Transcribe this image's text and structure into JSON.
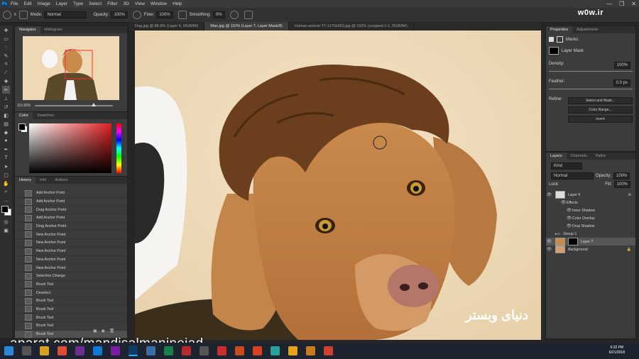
{
  "app": {
    "logo": "Ps",
    "menu": [
      "File",
      "Edit",
      "Image",
      "Layer",
      "Type",
      "Select",
      "Filter",
      "3D",
      "View",
      "Window",
      "Help"
    ],
    "watermark": "w0w.ir",
    "window_controls": [
      "—",
      "❐",
      "✕"
    ]
  },
  "options": {
    "mode_label": "Mode:",
    "mode_value": "Normal",
    "opacity_label": "Opacity:",
    "opacity_value": "100%",
    "flow_label": "Flow:",
    "flow_value": "100%",
    "smoothing_label": "Smoothing:",
    "smoothing_value": "0%",
    "brush_size": "5"
  },
  "navigator": {
    "tabs": [
      "Navigator",
      "Histogram"
    ],
    "zoom": "110.96%"
  },
  "color": {
    "tabs": [
      "Color",
      "Swatches"
    ]
  },
  "history": {
    "tabs": [
      "History",
      "Info",
      "Actions"
    ],
    "items": [
      "Add Anchor Point",
      "Add Anchor Point",
      "Drag Anchor Point",
      "Add Anchor Point",
      "Drag Anchor Point",
      "New Anchor Point",
      "New Anchor Point",
      "New Anchor Point",
      "New Anchor Point",
      "New Anchor Point",
      "Selection Change",
      "Brush Tool",
      "Deselect",
      "Brush Tool",
      "Brush Tool",
      "Brush Tool",
      "Brush Tool",
      "Brush Tool"
    ]
  },
  "doc_tabs": [
    "Dog.jpg @ 86.8% (Layer 6, RGB/8#)",
    "Man.jpg @ 110% (Layer 7, Layer Mask/8)",
    "Human-animal-YT-1170x563.jpg @ 102% (cropped-1-1, RGB/8#)"
  ],
  "properties": {
    "tabs": [
      "Properties",
      "Adjustments"
    ],
    "title": "Masks",
    "mask_label": "Layer Mask",
    "density_label": "Density:",
    "density_value": "100%",
    "feather_label": "Feather:",
    "feather_value": "0.0 px",
    "refine_label": "Refine:",
    "buttons": [
      "Select and Mask...",
      "Color Range...",
      "Invert"
    ]
  },
  "layers": {
    "tabs": [
      "Layers",
      "Channels",
      "Paths"
    ],
    "kind": "Kind",
    "blend": "Normal",
    "opacity_label": "Opacity:",
    "opacity_value": "100%",
    "lock_label": "Lock:",
    "fill_label": "Fill:",
    "fill_value": "100%",
    "rows": [
      {
        "name": "Layer 6",
        "fx": "fx"
      },
      {
        "name": "Effects"
      },
      {
        "name": "Inner Shadow"
      },
      {
        "name": "Color Overlay"
      },
      {
        "name": "Drop Shadow"
      },
      {
        "name": "Group 1"
      },
      {
        "name": "Layer 7"
      },
      {
        "name": "Background"
      }
    ]
  },
  "overlay": {
    "aparat": "aparat.com/mandisalmaninejad",
    "logo_text": "دنیای وبستر"
  },
  "taskbar": {
    "time": "6:32 PM",
    "date": "6/21/2018"
  }
}
